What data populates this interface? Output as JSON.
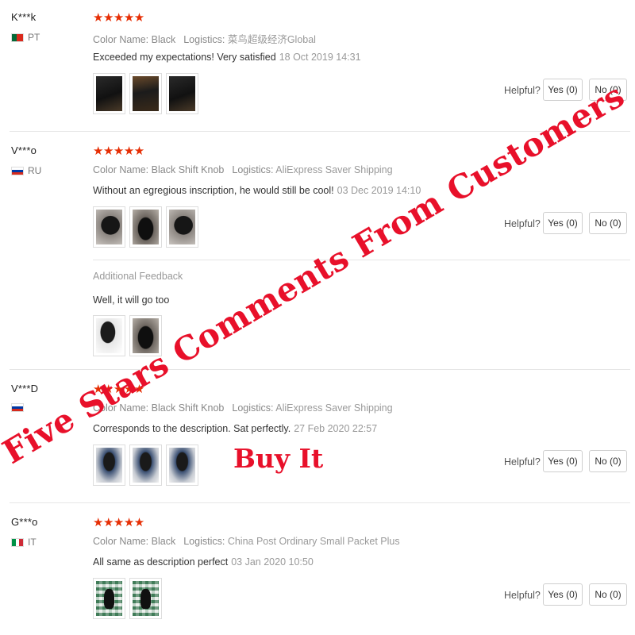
{
  "labels": {
    "color_name": "Color Name:",
    "logistics": "Logistics:",
    "helpful": "Helpful?",
    "additional_feedback": "Additional Feedback"
  },
  "overlay": {
    "slogan": "Five Stars Comments From Customers",
    "cta": "Buy It"
  },
  "reviews": [
    {
      "user": "K***k",
      "country": "PT",
      "flag_colors": [
        "#046a38",
        "#da291c"
      ],
      "stars": "★★★★★",
      "rating": 5,
      "color_name": "Black",
      "logistics": "菜鸟超级经济Global",
      "text": "Exceeded my expectations! Very satisfied",
      "date": "18 Oct 2019 14:31",
      "yes_label": "Yes (0)",
      "no_label": "No (0)",
      "thumb_styles": [
        "ph-dark",
        "ph-brown",
        "ph-dark"
      ]
    },
    {
      "user": "V***o",
      "country": "RU",
      "flag_colors": [
        "#ffffff",
        "#0039a6",
        "#d52b1e"
      ],
      "stars": "★★★★★",
      "rating": 5,
      "color_name": "Black Shift Knob",
      "logistics": "AliExpress Saver Shipping",
      "text": "Without an egregious inscription, he would still be cool!",
      "date": "03 Dec 2019 14:10",
      "yes_label": "Yes (0)",
      "no_label": "No (0)",
      "thumb_styles": [
        "ph-knob",
        "ph-knob2",
        "ph-knob"
      ],
      "additional": {
        "text": "Well, it will go too",
        "thumb_styles": [
          "ph-white",
          "ph-knob2"
        ]
      }
    },
    {
      "user": "V***D",
      "country": "",
      "flag_colors": [
        "#ffffff",
        "#0039a6",
        "#d52b1e"
      ],
      "stars": "★★★★★",
      "rating": 5,
      "color_name": "Black Shift Knob",
      "logistics": "AliExpress Saver Shipping",
      "text": "Corresponds to the description. Sat perfectly.",
      "date": "27 Feb 2020 22:57",
      "yes_label": "Yes (0)",
      "no_label": "No (0)",
      "thumb_styles": [
        "ph-blue",
        "ph-blue",
        "ph-blue"
      ]
    },
    {
      "user": "G***o",
      "country": "IT",
      "flag_colors": [
        "#009246",
        "#ffffff",
        "#ce2b37"
      ],
      "stars": "★★★★★",
      "rating": 5,
      "color_name": "Black",
      "logistics": "China Post Ordinary Small Packet Plus",
      "text": "All same as description perfect",
      "date": "03 Jan 2020 10:50",
      "yes_label": "Yes (0)",
      "no_label": "No (0)",
      "thumb_styles": [
        "ph-plaid",
        "ph-plaid"
      ]
    }
  ]
}
